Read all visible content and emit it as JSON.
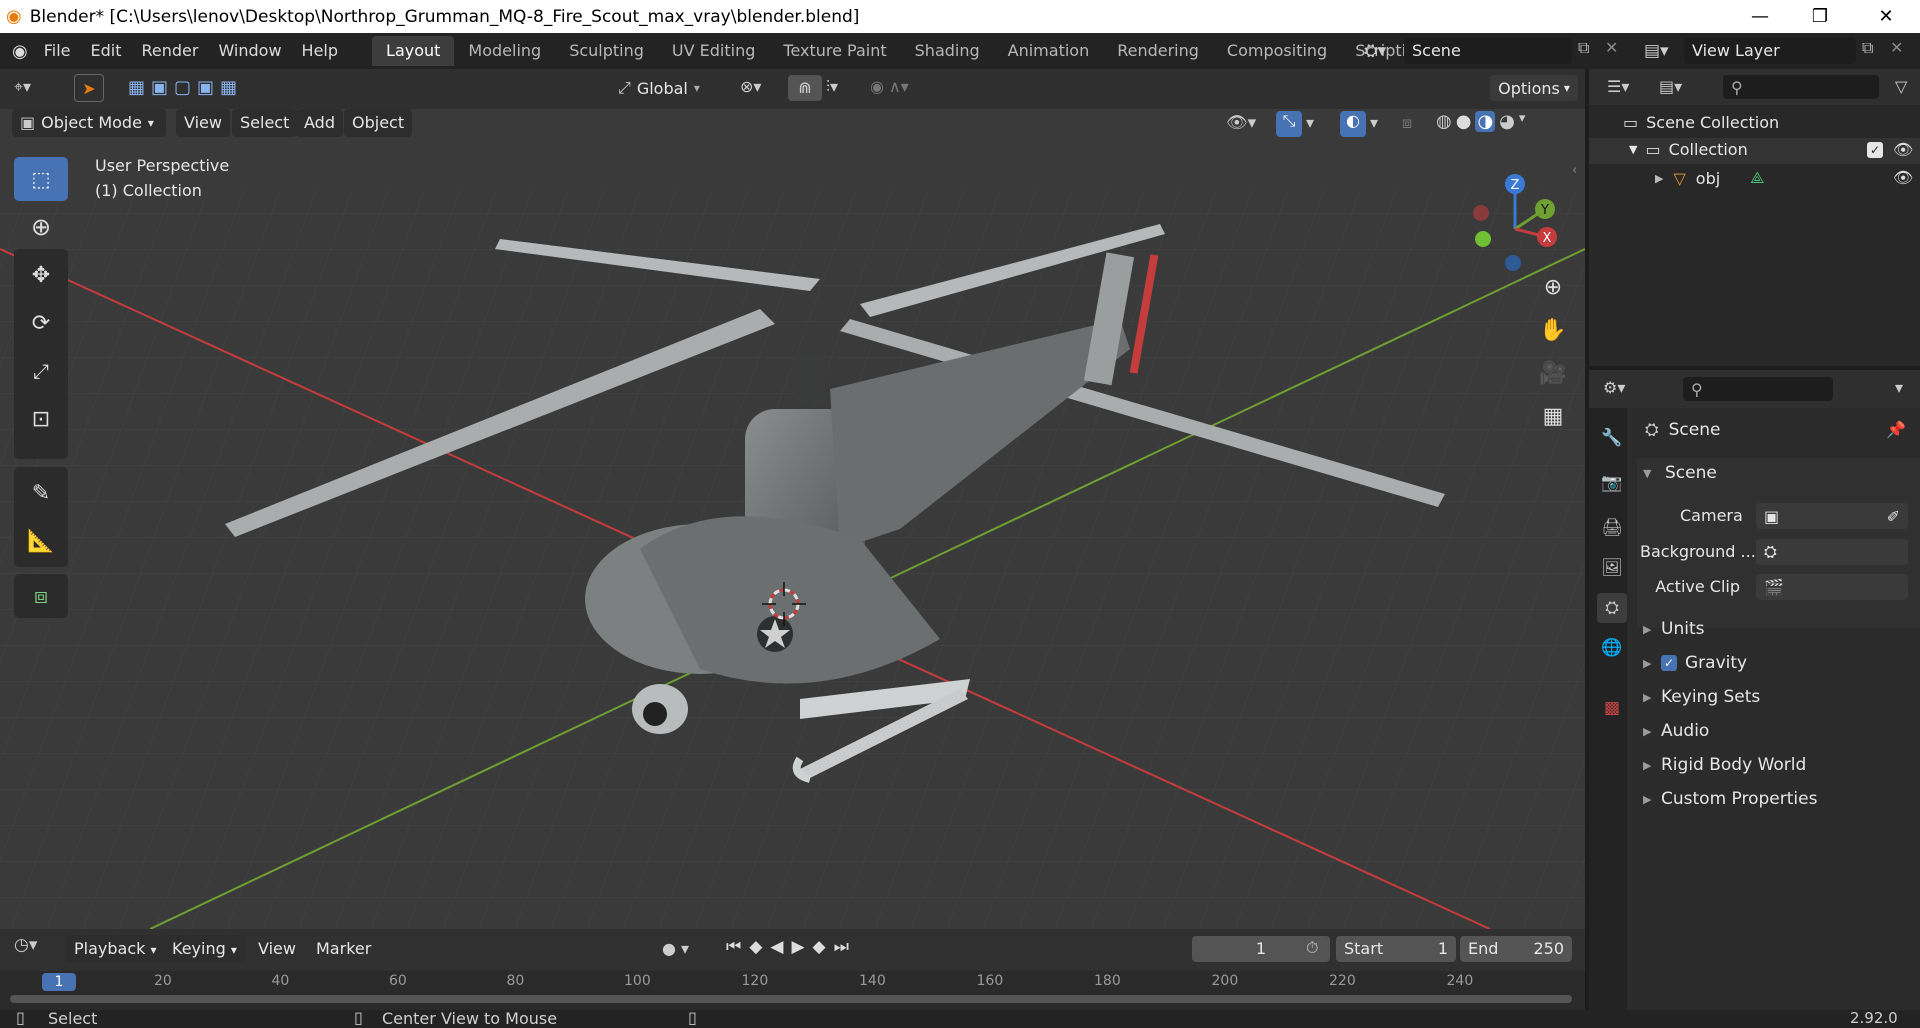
{
  "window": {
    "title": "Blender* [C:\\Users\\lenov\\Desktop\\Northrop_Grumman_MQ-8_Fire_Scout_max_vray\\blender.blend]",
    "minimize": "—",
    "maximize": "❐",
    "close": "✕"
  },
  "menus": [
    "File",
    "Edit",
    "Render",
    "Window",
    "Help"
  ],
  "workspaces": [
    "Layout",
    "Modeling",
    "Sculpting",
    "UV Editing",
    "Texture Paint",
    "Shading",
    "Animation",
    "Rendering",
    "Compositing",
    "Scripting"
  ],
  "workspace_add": "+",
  "scene_field": "Scene",
  "view_layer_field": "View Layer",
  "tool_header": {
    "transform_orientation": "Global",
    "options": "Options"
  },
  "viewport_header": {
    "mode": "Object Mode",
    "menus": [
      "View",
      "Select",
      "Add",
      "Object"
    ]
  },
  "overlay_text": {
    "perspective": "User Perspective",
    "collection": "(1) Collection"
  },
  "gizmo": {
    "z": "Z",
    "y": "Y",
    "x": "X"
  },
  "outliner": {
    "root": "Scene Collection",
    "collection": "Collection",
    "object": "obj"
  },
  "properties": {
    "context": "Scene",
    "panel": "Scene",
    "camera_label": "Camera",
    "background_label": "Background ...",
    "active_clip_label": "Active Clip",
    "subpanels": [
      "Units",
      "Gravity",
      "Keying Sets",
      "Audio",
      "Rigid Body World",
      "Custom Properties"
    ],
    "gravity_checked": true
  },
  "timeline": {
    "menus": [
      "Playback",
      "Keying",
      "View",
      "Marker"
    ],
    "current_frame": "1",
    "start_label": "Start",
    "start_value": "1",
    "end_label": "End",
    "end_value": "250",
    "ticks": [
      "20",
      "40",
      "60",
      "80",
      "100",
      "120",
      "140",
      "160",
      "180",
      "200",
      "220",
      "240"
    ],
    "current_marker": "1"
  },
  "statusbar": {
    "select": "Select",
    "center": "Center View to Mouse",
    "version": "2.92.0"
  },
  "colors": {
    "accent": "#4772b3",
    "x_axis": "#c43c3c",
    "y_axis": "#6fa032",
    "z_axis": "#3a7ad6"
  }
}
